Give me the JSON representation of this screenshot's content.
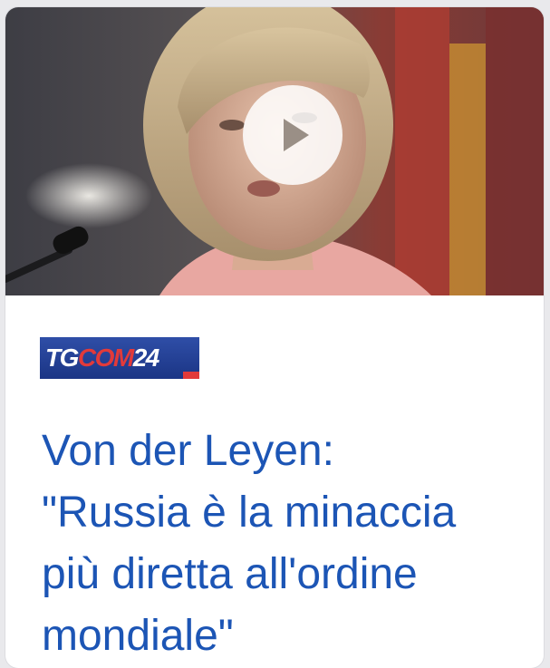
{
  "article": {
    "thumbnail": {
      "alt": "Photo of Ursula von der Leyen speaking",
      "play_icon": "play-icon"
    },
    "source": {
      "tg": "TG",
      "com": "COM",
      "num": "24"
    },
    "headline_lines": [
      "Von der Leyen:",
      "\"Russia è la minaccia",
      "più diretta all'ordine",
      "mondiale\""
    ],
    "colors": {
      "headline": "#1c55b5",
      "logo_bg": "#1b3585",
      "logo_accent": "#e23a3a"
    }
  }
}
